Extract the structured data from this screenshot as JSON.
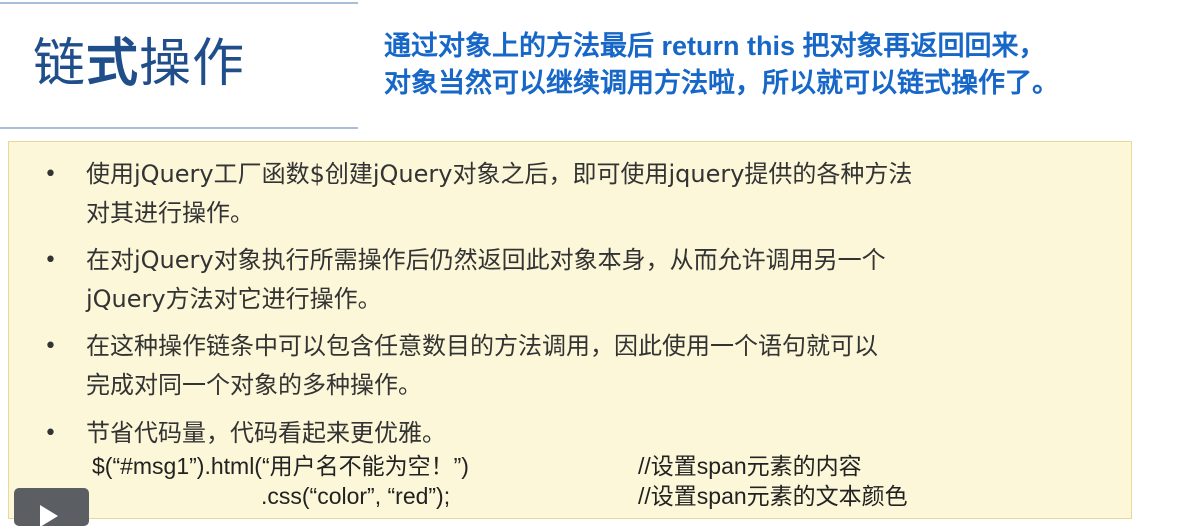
{
  "slide": {
    "title_part1": "链",
    "title_part2": "式",
    "title_part3": "操作",
    "subtitle_line1": "通过对象上的方法最后 return this 把对象再返回回来，",
    "subtitle_line2": "对象当然可以继续调用方法啦，所以就可以链式操作了。"
  },
  "bullets": [
    {
      "marker": "•",
      "lines": [
        "使用jQuery工厂函数$创建jQuery对象之后，即可使用jquery提供的各种方法",
        "对其进行操作。"
      ]
    },
    {
      "marker": "•",
      "lines": [
        "在对jQuery对象执行所需操作后仍然返回此对象本身，从而允许调用另一个",
        "jQuery方法对它进行操作。"
      ]
    },
    {
      "marker": "•",
      "lines": [
        "在这种操作链条中可以包含任意数目的方法调用，因此使用一个语句就可以",
        "完成对同一个对象的多种操作。"
      ]
    },
    {
      "marker": "•",
      "lines": [
        "节省代码量，代码看起来更优雅。"
      ]
    }
  ],
  "code": {
    "line1": "$(“#msg1”).html(“用户名不能为空！”)",
    "line1_comment": "//设置span元素的内容",
    "line2": ".css(“color”, “red”);",
    "line2_comment": "//设置span元素的文本颜色"
  },
  "colors": {
    "title": "#1f4e8a",
    "subtitle": "#1667c7",
    "content_bg": "#fbf7d8",
    "content_border": "#e6d99a",
    "rule": "#a8bfd6"
  },
  "player": {
    "icon": "play-icon"
  }
}
